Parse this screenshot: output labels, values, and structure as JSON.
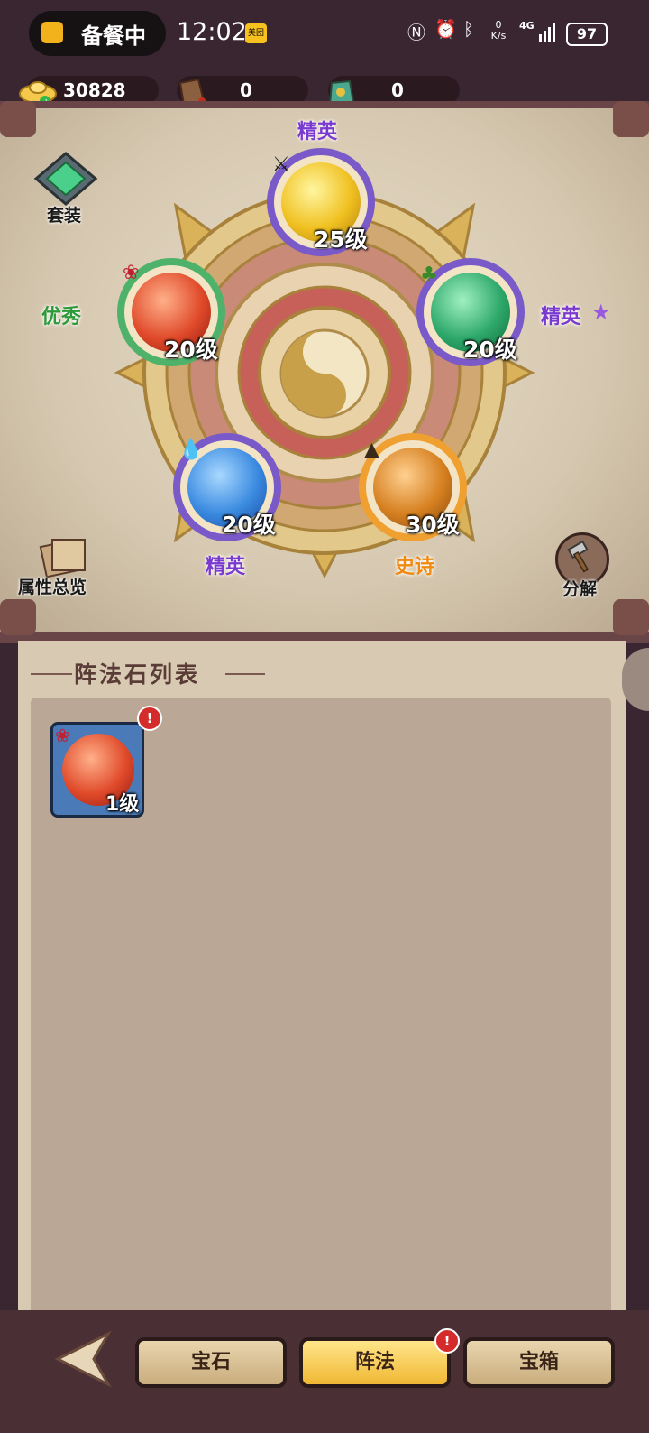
{
  "status_bar": {
    "pill_text": "备餐中",
    "time": "12:02",
    "meituan": "美团",
    "net_speed": "0 K/s",
    "signal": "4G",
    "battery": "97"
  },
  "currency": [
    {
      "icon": "gold-ingot-icon",
      "value": "30828"
    },
    {
      "icon": "scroll-bag-icon",
      "value": "0"
    },
    {
      "icon": "jade-bag-icon",
      "value": "0"
    }
  ],
  "board": {
    "set_button": "套装",
    "overview_button": "属性总览",
    "decompose_button": "分解",
    "orbs": [
      {
        "element": "metal",
        "icon": "crossed-swords-icon",
        "level": "25级",
        "rank": "精英",
        "ring": "#7a5ac8",
        "color": "#f0c020"
      },
      {
        "element": "wood",
        "icon": "tree-icon",
        "level": "20级",
        "rank": "精英",
        "ring": "#7a5ac8",
        "color": "#2ea86a"
      },
      {
        "element": "earth",
        "icon": "mountain-icon",
        "level": "30级",
        "rank": "史诗",
        "ring": "#f0a030",
        "color": "#d68020"
      },
      {
        "element": "water",
        "icon": "water-drop-icon",
        "level": "20级",
        "rank": "精英",
        "ring": "#7a5ac8",
        "color": "#3a8ae0"
      },
      {
        "element": "fire",
        "icon": "flame-icon",
        "level": "20级",
        "rank": "优秀",
        "ring": "#4fb26a",
        "color": "#e04a2a"
      }
    ]
  },
  "list": {
    "title": "阵法石列表",
    "items": [
      {
        "element": "fire",
        "level": "1级",
        "badge": "!"
      }
    ]
  },
  "tabs": [
    {
      "label": "宝石",
      "active": false
    },
    {
      "label": "阵法",
      "active": true,
      "badge": "!"
    },
    {
      "label": "宝箱",
      "active": false
    }
  ],
  "colors": {
    "elite": "#7a3ad0",
    "excellent": "#2e9a3a",
    "epic": "#f08a10"
  }
}
